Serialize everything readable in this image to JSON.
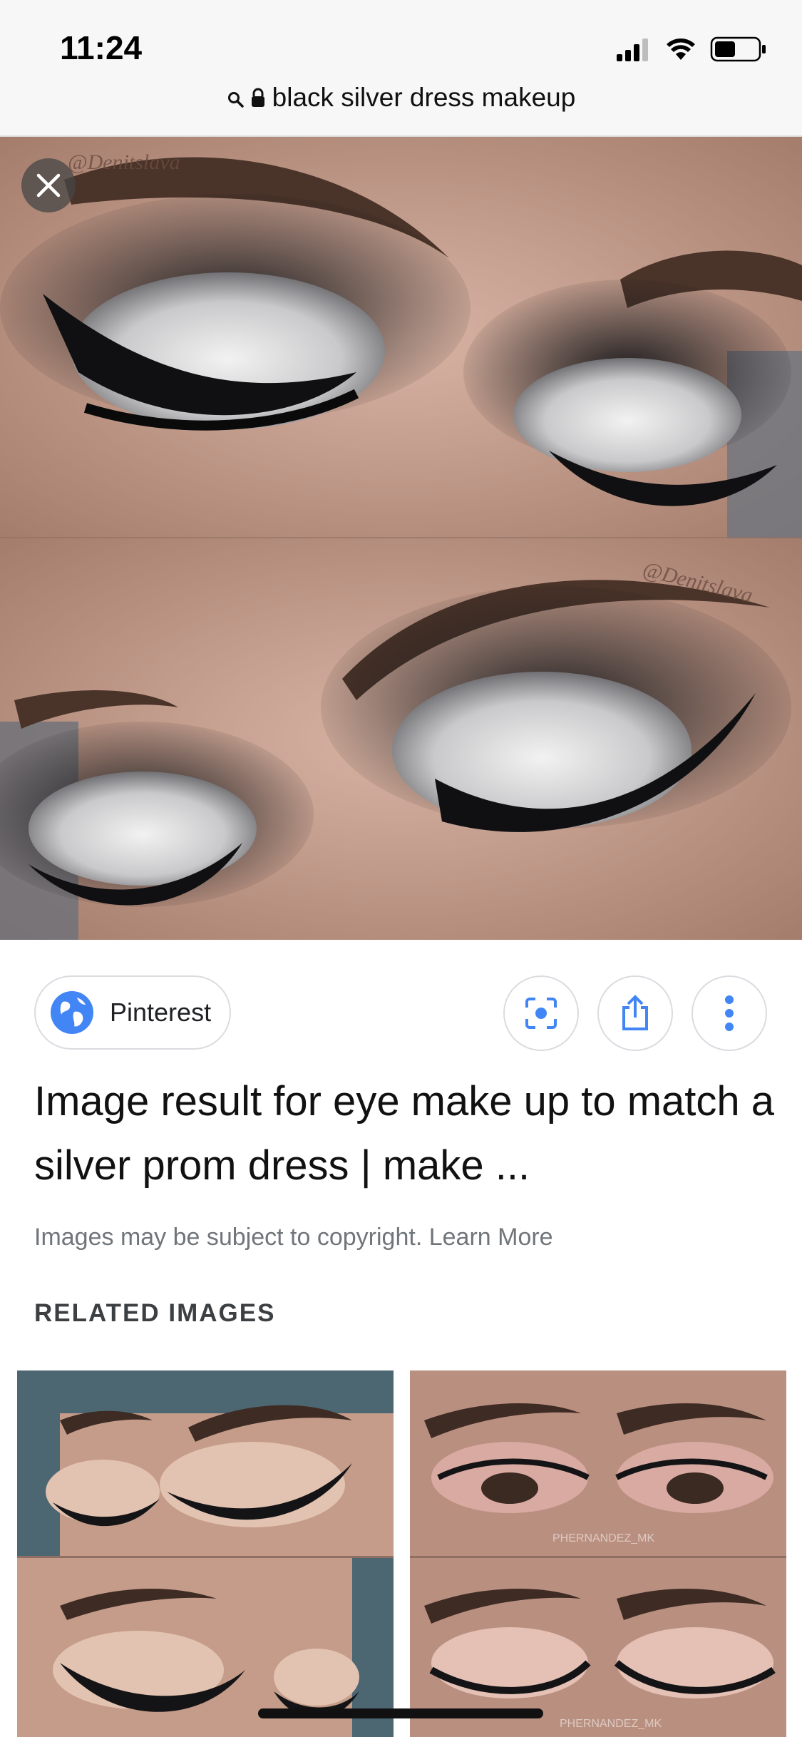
{
  "status_bar": {
    "time": "11:24",
    "icons": [
      "cellular-signal-icon",
      "wifi-icon",
      "battery-icon"
    ]
  },
  "url_bar": {
    "query": "black silver dress makeup",
    "icons": [
      "search-icon",
      "lock-icon"
    ]
  },
  "hero_image": {
    "watermark_top": "@Denitslava",
    "watermark_bottom": "@Denitslava"
  },
  "source": {
    "label": "Pinterest",
    "icon": "globe-icon"
  },
  "actions": {
    "icons": [
      "lens-icon",
      "share-icon",
      "more-icon"
    ]
  },
  "result": {
    "title": "Image result for eye make up to match a silver prom dress | make ...",
    "copyright_text": "Images may be subject to copyright. Learn More"
  },
  "related": {
    "heading": "RELATED IMAGES",
    "watermark_right_top": "PHERNANDEZ_MK",
    "watermark_right_bottom": "PHERNANDEZ_MK"
  },
  "colors": {
    "accent_blue": "#4285f4",
    "text_primary": "#111111",
    "text_secondary": "#70757a"
  }
}
